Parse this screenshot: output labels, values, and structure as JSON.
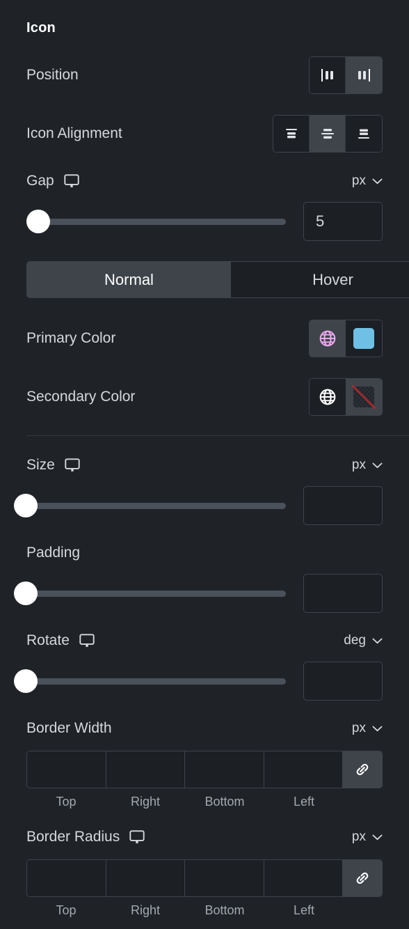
{
  "section": {
    "title": "Icon"
  },
  "position": {
    "label": "Position",
    "options": [
      {
        "name": "align-start-vertical-icon",
        "value": "start",
        "active": false
      },
      {
        "name": "align-end-vertical-icon",
        "value": "end",
        "active": true
      }
    ]
  },
  "icon_alignment": {
    "label": "Icon Alignment",
    "options": [
      {
        "name": "align-top-icon",
        "value": "top",
        "active": false
      },
      {
        "name": "align-middle-icon",
        "value": "middle",
        "active": true
      },
      {
        "name": "align-bottom-icon",
        "value": "bottom",
        "active": false
      }
    ]
  },
  "gap": {
    "label": "Gap",
    "device_icon": "desktop-icon",
    "unit": "px",
    "value": "5",
    "placeholder": "",
    "slider_percent": 0
  },
  "state_tabs": {
    "tabs": [
      {
        "label": "Normal",
        "active": true
      },
      {
        "label": "Hover",
        "active": false
      }
    ]
  },
  "primary_color": {
    "label": "Primary Color",
    "globe_icon": "globe-icon",
    "globe_color": "#e8a7ea",
    "globe_active": true,
    "swatch_color": "#6ec1e4",
    "swatch_empty": false
  },
  "secondary_color": {
    "label": "Secondary Color",
    "globe_icon": "globe-icon",
    "globe_color": "#ffffff",
    "globe_active": false,
    "swatch_color": "",
    "swatch_empty": true
  },
  "size": {
    "label": "Size",
    "device_icon": "desktop-icon",
    "unit": "px",
    "value": "",
    "slider_percent": 0
  },
  "padding": {
    "label": "Padding",
    "device_icon": "",
    "unit": "",
    "value": "",
    "slider_percent": 0
  },
  "rotate": {
    "label": "Rotate",
    "device_icon": "desktop-icon",
    "unit": "deg",
    "value": "",
    "slider_percent": 0
  },
  "border_width": {
    "label": "Border Width",
    "device_icon": "",
    "unit": "px",
    "values": [
      "",
      "",
      "",
      ""
    ],
    "side_labels": [
      "Top",
      "Right",
      "Bottom",
      "Left"
    ],
    "link_icon": "link-icon",
    "linked": true
  },
  "border_radius": {
    "label": "Border Radius",
    "device_icon": "desktop-icon",
    "unit": "px",
    "values": [
      "",
      "",
      "",
      ""
    ],
    "side_labels": [
      "Top",
      "Right",
      "Bottom",
      "Left"
    ],
    "link_icon": "link-icon",
    "linked": true
  },
  "theme": {
    "background": "#1f2327",
    "control_bg": "#1c1f24",
    "control_active_bg": "#3f444b",
    "border": "#3f444b",
    "text": "#d5d8dc",
    "accent": "#6ec1e4"
  }
}
